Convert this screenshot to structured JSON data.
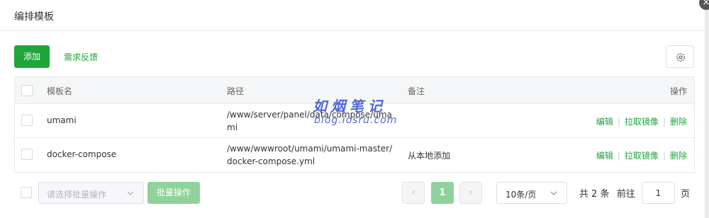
{
  "dialog": {
    "title": "编排模板",
    "close_glyph": "×"
  },
  "toolbar": {
    "add_label": "添加",
    "feedback_label": "需求反馈",
    "settings_icon": "gear-icon"
  },
  "table": {
    "headers": [
      "模板名",
      "路径",
      "备注",
      "操作"
    ],
    "rows": [
      {
        "name": "umami",
        "path": "/www/server/panel/data/compose/umami",
        "note": "",
        "actions": [
          "编辑",
          "拉取镜像",
          "删除"
        ]
      },
      {
        "name": "docker-compose",
        "path": "/www/wwwroot/umami/umami-master/docker-compose.yml",
        "note": "从本地添加",
        "actions": [
          "编辑",
          "拉取镜像",
          "删除"
        ]
      }
    ]
  },
  "watermark": {
    "text": "如烟笔记",
    "url": "blog.iosru.com"
  },
  "footer": {
    "batch_select_placeholder": "请选择批量操作",
    "batch_button_label": "批量操作",
    "prev_glyph": "‹",
    "next_glyph": "›",
    "current_page": "1",
    "page_size": "10条/页",
    "total_text": "共 2 条",
    "goto_label": "前往",
    "goto_value": "1",
    "page_suffix": "页"
  },
  "colors": {
    "accent": "#20a53a",
    "accent_disabled": "#90d29c",
    "watermark": "#4e67d8"
  }
}
